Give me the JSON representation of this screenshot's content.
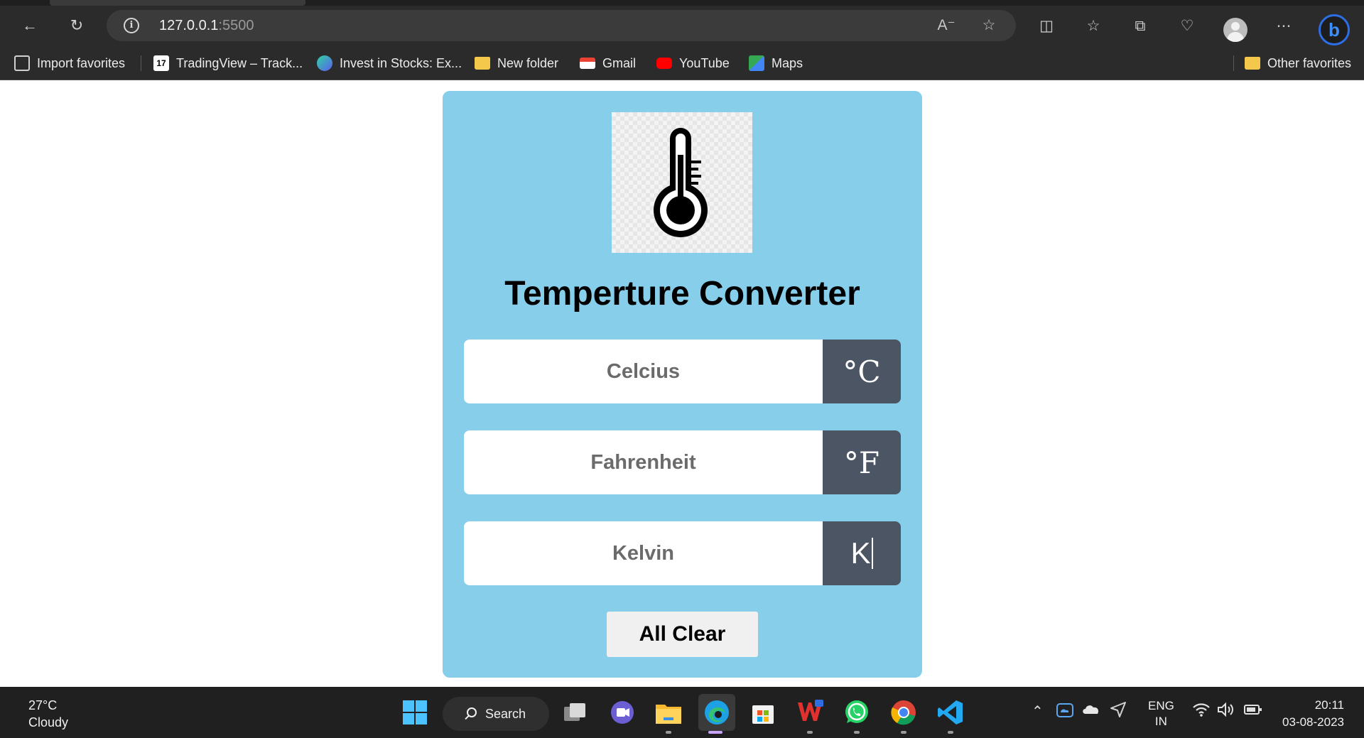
{
  "browser": {
    "url_host": "127.0.0.1",
    "url_port": ":5500"
  },
  "favorites": [
    {
      "label": "Import favorites"
    },
    {
      "label": "TradingView – Track..."
    },
    {
      "label": "Invest in Stocks: Ex..."
    },
    {
      "label": "New folder"
    },
    {
      "label": "Gmail"
    },
    {
      "label": "YouTube"
    },
    {
      "label": "Maps"
    }
  ],
  "other_favorites": "Other favorites",
  "converter": {
    "title": "Temperture Converter",
    "celsius_placeholder": "Celcius",
    "celsius_unit": "°C",
    "fahrenheit_placeholder": "Fahrenheit",
    "fahrenheit_unit": "°F",
    "kelvin_placeholder": "Kelvin",
    "kelvin_unit": "K",
    "clear_label": "All Clear"
  },
  "taskbar": {
    "weather_temp": "27°C",
    "weather_desc": "Cloudy",
    "search_label": "Search",
    "lang_line1": "ENG",
    "lang_line2": "IN",
    "time": "20:11",
    "date": "03-08-2023"
  },
  "colors": {
    "card_bg": "#87ceeb",
    "unit_bg": "#4b5563"
  }
}
